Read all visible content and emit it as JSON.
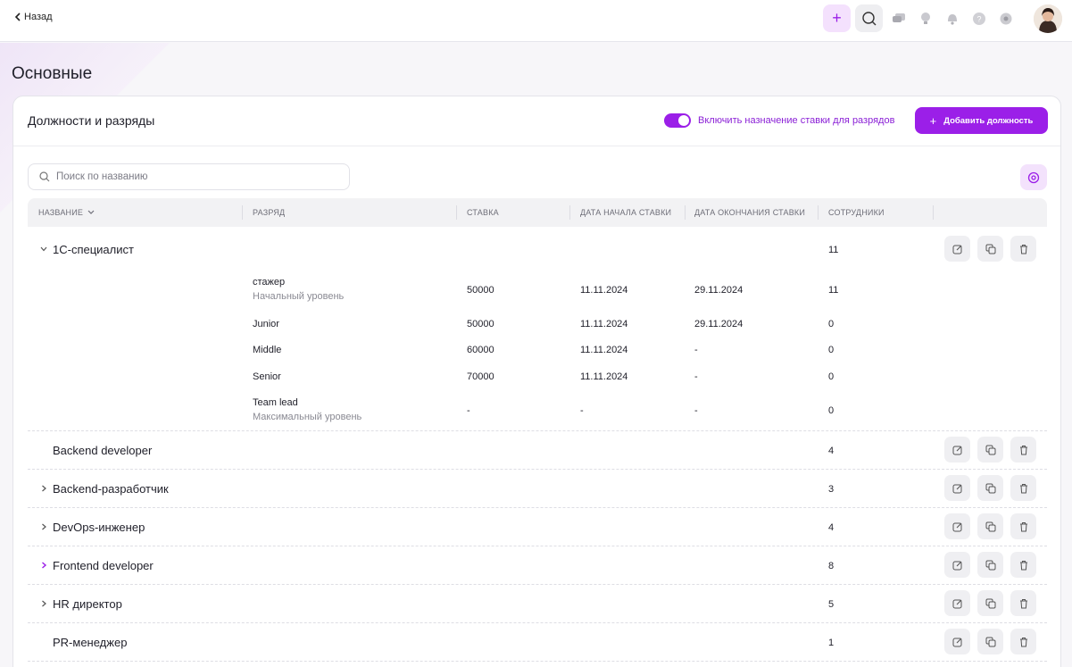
{
  "topbar": {
    "back_label": "Назад",
    "icons": [
      "plus-icon",
      "search-icon",
      "chat-icon",
      "lightbulb-icon",
      "bell-icon",
      "help-icon",
      "settings-icon"
    ]
  },
  "page": {
    "title": "Основные"
  },
  "card": {
    "title": "Должности и разряды",
    "toggle_label": "Включить назначение ставки для разрядов",
    "toggle_on": true,
    "add_button": "Добавить должность"
  },
  "search": {
    "placeholder": "Поиск по названию",
    "value": ""
  },
  "table": {
    "headers": {
      "name": "НАЗВАНИЕ",
      "grade": "РАЗРЯД",
      "rate": "СТАВКА",
      "start": "ДАТА НАЧАЛА СТАВКИ",
      "end": "ДАТА ОКОНЧАНИЯ СТАВКИ",
      "employees": "СОТРУДНИКИ"
    },
    "expanded": {
      "name": "1С-специалист",
      "count": "11",
      "grades": [
        {
          "grade": "стажер",
          "level": "Начальный уровень",
          "rate": "50000",
          "start": "11.11.2024",
          "end": "29.11.2024",
          "count": "11"
        },
        {
          "grade": "Junior",
          "level": "",
          "rate": "50000",
          "start": "11.11.2024",
          "end": "29.11.2024",
          "count": "0"
        },
        {
          "grade": "Middle",
          "level": "",
          "rate": "60000",
          "start": "11.11.2024",
          "end": "-",
          "count": "0"
        },
        {
          "grade": "Senior",
          "level": "",
          "rate": "70000",
          "start": "11.11.2024",
          "end": "-",
          "count": "0"
        },
        {
          "grade": "Team lead",
          "level": "Максимальный уровень",
          "rate": "-",
          "start": "-",
          "end": "-",
          "count": "0"
        }
      ]
    },
    "groups": [
      {
        "name": "Backend developer",
        "count": "4"
      },
      {
        "name": "Backend-разработчик",
        "count": "3"
      },
      {
        "name": "DevOps-инженер",
        "count": "4"
      },
      {
        "name": "Frontend developer",
        "count": "8"
      },
      {
        "name": "HR директор",
        "count": "5"
      },
      {
        "name": "PR-менеджер",
        "count": "1"
      }
    ]
  },
  "colors": {
    "accent": "#9b1fe8",
    "accent_light": "#f3e2fc"
  }
}
